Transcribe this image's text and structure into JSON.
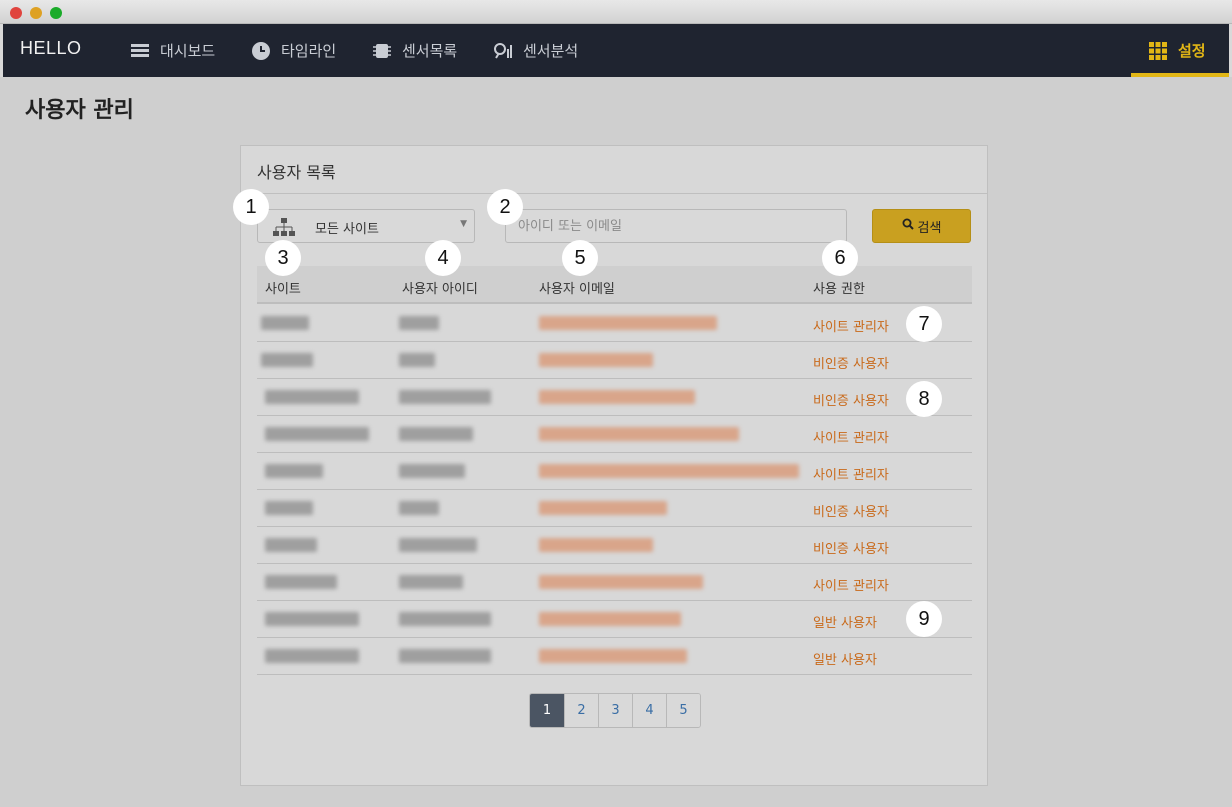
{
  "app": {
    "brand": "HELLO"
  },
  "nav": {
    "items": [
      {
        "label": "대시보드",
        "icon": "dashboard-icon"
      },
      {
        "label": "타임라인",
        "icon": "clock-icon"
      },
      {
        "label": "센서목록",
        "icon": "chip-icon"
      },
      {
        "label": "센서분석",
        "icon": "analysis-icon"
      }
    ],
    "settings": {
      "label": "설정",
      "icon": "grid-icon"
    },
    "accent_color": "#e2b615"
  },
  "page": {
    "title": "사용자 관리"
  },
  "panel": {
    "title": "사용자 목록",
    "site_select": {
      "value": "모든 사이트",
      "icon": "sitemap-icon"
    },
    "search": {
      "placeholder": "아이디 또는 이메일",
      "button_label": "검색",
      "icon": "search-icon"
    },
    "columns": [
      "사이트",
      "사용자 아이디",
      "사용자 이메일",
      "사용 권한"
    ],
    "rows": [
      {
        "role": "사이트 관리자"
      },
      {
        "role": "비인증 사용자"
      },
      {
        "role": "비인증 사용자"
      },
      {
        "role": "사이트 관리자"
      },
      {
        "role": "사이트 관리자"
      },
      {
        "role": "비인증 사용자"
      },
      {
        "role": "비인증 사용자"
      },
      {
        "role": "사이트 관리자"
      },
      {
        "role": "일반 사용자"
      },
      {
        "role": "일반 사용자"
      }
    ],
    "pagination": [
      "1",
      "2",
      "3",
      "4",
      "5"
    ],
    "active_page": "1"
  },
  "annotations": [
    "1",
    "2",
    "3",
    "4",
    "5",
    "6",
    "7",
    "8",
    "9"
  ]
}
